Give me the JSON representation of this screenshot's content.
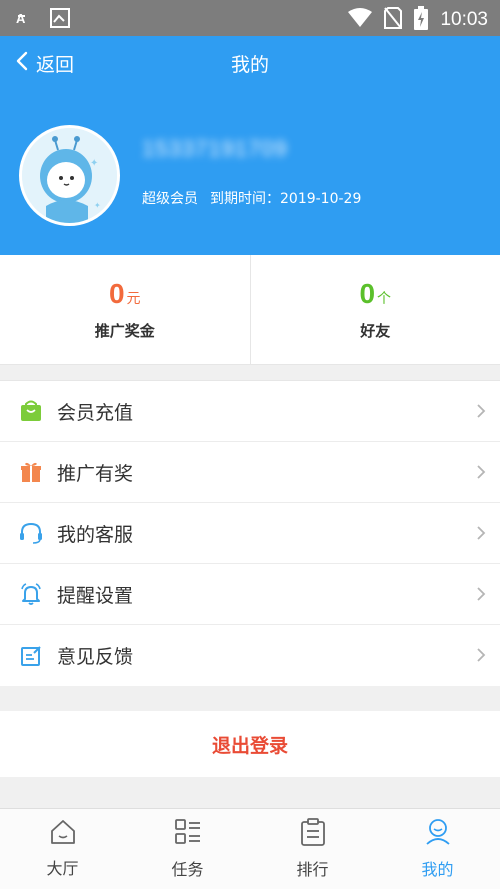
{
  "status_bar": {
    "time": "10:03"
  },
  "header": {
    "back_label": "返回",
    "title": "我的",
    "phone": "15337191709",
    "membership": "超级会员",
    "expiry": "到期时间：2019-10-29"
  },
  "stats": [
    {
      "value": "0",
      "unit": "元",
      "label": "推广奖金"
    },
    {
      "value": "0",
      "unit": "个",
      "label": "好友"
    }
  ],
  "menu": [
    {
      "label": "会员充值",
      "icon": "shopping-bag-icon"
    },
    {
      "label": "推广有奖",
      "icon": "gift-icon"
    },
    {
      "label": "我的客服",
      "icon": "headset-icon"
    },
    {
      "label": "提醒设置",
      "icon": "bell-icon"
    },
    {
      "label": "意见反馈",
      "icon": "feedback-icon"
    }
  ],
  "logout_label": "退出登录",
  "tabs": [
    {
      "label": "大厅",
      "icon": "home-icon"
    },
    {
      "label": "任务",
      "icon": "grid-list-icon"
    },
    {
      "label": "排行",
      "icon": "clipboard-icon"
    },
    {
      "label": "我的",
      "icon": "user-icon",
      "active": true
    }
  ],
  "colors": {
    "primary": "#2f9df2",
    "bonus_red": "#f26a3c",
    "friend_green": "#5bc02b",
    "logout_red": "#e94b35"
  }
}
